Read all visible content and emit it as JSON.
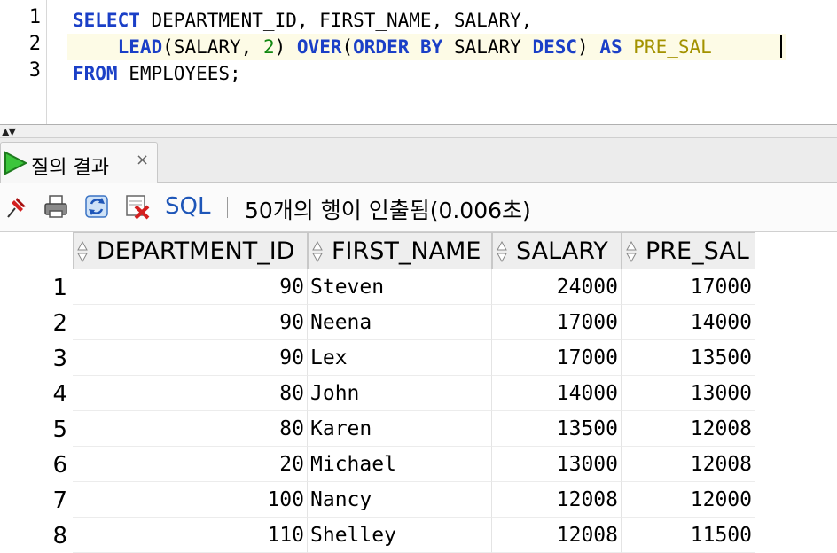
{
  "editor": {
    "line_numbers": [
      "1",
      "2",
      "3"
    ],
    "line1": {
      "kw_select": "SELECT",
      "cols": " DEPARTMENT_ID, FIRST_NAME, SALARY,"
    },
    "line2": {
      "indent": "    ",
      "fn_lead": "LEAD",
      "p1": "(SALARY, ",
      "num": "2",
      "p2": ") ",
      "kw_over": "OVER",
      "p3": "(",
      "kw_orderby": "ORDER BY",
      "p4": " SALARY ",
      "kw_desc": "DESC",
      "p5": ") ",
      "kw_as": "AS",
      "p6": " ",
      "alias": "PRE_SAL"
    },
    "line3": {
      "kw_from": "FROM",
      "rest": " EMPLOYEES;"
    }
  },
  "splitter": {
    "arrows": "▲▼"
  },
  "results_tab": {
    "label": "질의 결과",
    "close": "×"
  },
  "toolbar": {
    "sql_label": "SQL",
    "status": "50개의 행이 인출됨(0.006초)"
  },
  "grid": {
    "columns": [
      "DEPARTMENT_ID",
      "FIRST_NAME",
      "SALARY",
      "PRE_SAL"
    ],
    "rows": [
      {
        "num": "1",
        "dept": "90",
        "name": "Steven",
        "salary": "24000",
        "pre": "17000"
      },
      {
        "num": "2",
        "dept": "90",
        "name": "Neena",
        "salary": "17000",
        "pre": "14000"
      },
      {
        "num": "3",
        "dept": "90",
        "name": "Lex",
        "salary": "17000",
        "pre": "13500"
      },
      {
        "num": "4",
        "dept": "80",
        "name": "John",
        "salary": "14000",
        "pre": "13000"
      },
      {
        "num": "5",
        "dept": "80",
        "name": "Karen",
        "salary": "13500",
        "pre": "12008"
      },
      {
        "num": "6",
        "dept": "20",
        "name": "Michael",
        "salary": "13000",
        "pre": "12008"
      },
      {
        "num": "7",
        "dept": "100",
        "name": "Nancy",
        "salary": "12008",
        "pre": "12000"
      },
      {
        "num": "8",
        "dept": "110",
        "name": "Shelley",
        "salary": "12008",
        "pre": "11500"
      }
    ]
  },
  "colors": {
    "keyword": "#1a3fc7",
    "number": "#118811",
    "alias": "#a39200",
    "sql_link": "#1e56b8"
  }
}
